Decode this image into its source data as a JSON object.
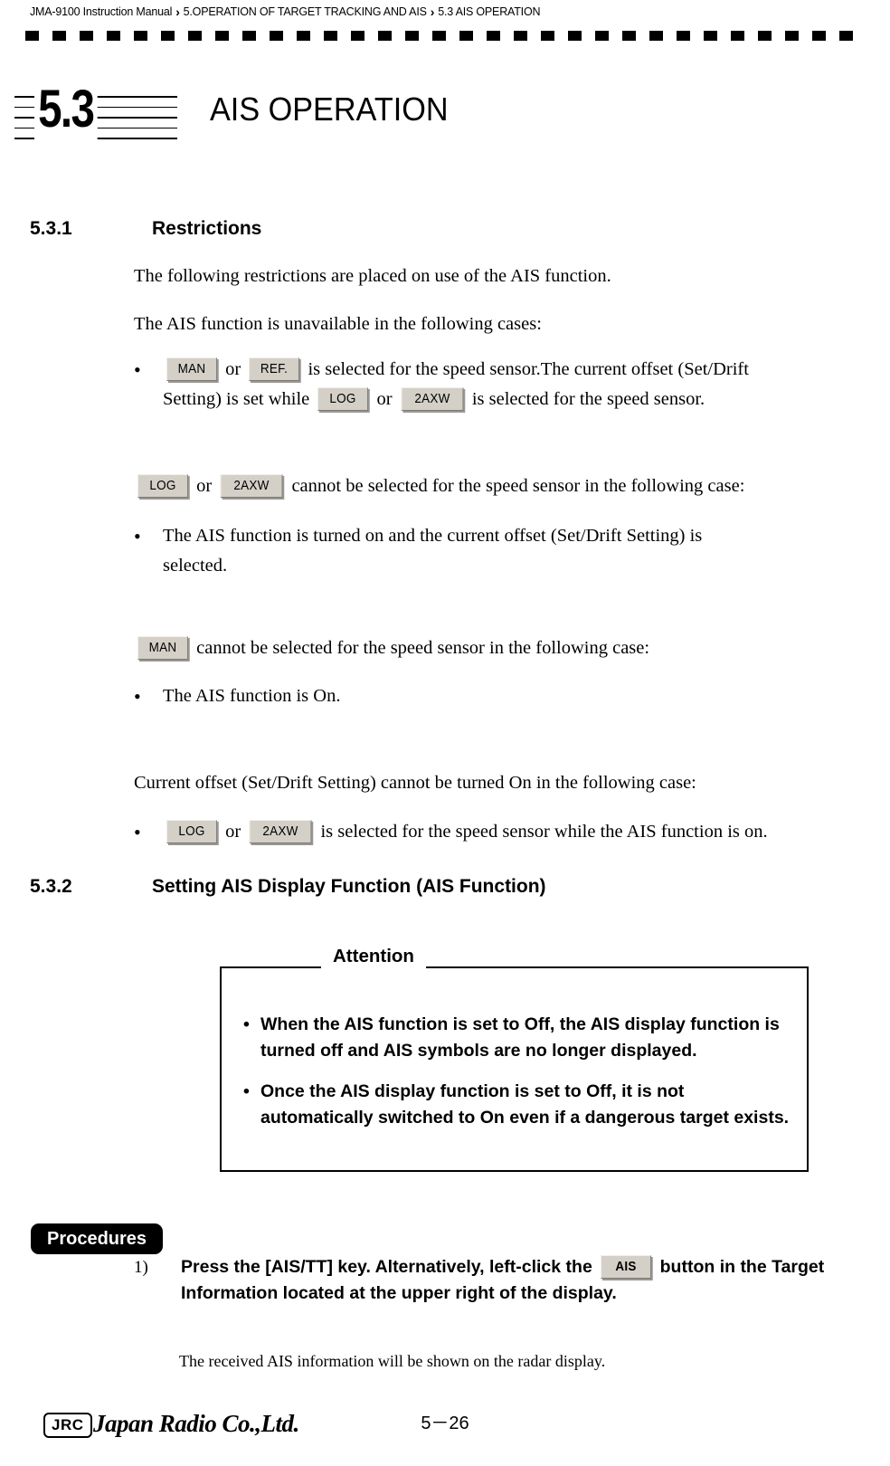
{
  "header": {
    "breadcrumb_parts": [
      "JMA-9100 Instruction Manual",
      "5.OPERATION OF TARGET TRACKING AND AIS",
      "5.3  AIS OPERATION"
    ],
    "separator": "›"
  },
  "chapter": {
    "number": "5.3",
    "title": "AIS OPERATION"
  },
  "sections": {
    "s531": {
      "number": "5.3.1",
      "title": "Restrictions"
    },
    "s532": {
      "number": "5.3.2",
      "title": "Setting AIS Display Function (AIS Function)"
    }
  },
  "body": {
    "p1": "The following restrictions are placed on use of the AIS function.",
    "p2": "The AIS function is unavailable in the following cases:",
    "b1": {
      "dot": "•",
      "t1": "or",
      "t2": "is selected for the speed sensor.The current offset (Set/Drift",
      "t3": "Setting) is set while",
      "t4": "or",
      "t5": "is selected for the speed sensor."
    },
    "p3": {
      "t1": "or",
      "t2": "cannot be selected for the speed sensor in the following case:"
    },
    "b2": {
      "dot": "•",
      "t1": "The AIS function is turned on and the current offset (Set/Drift Setting) is",
      "t2": "selected."
    },
    "p4": {
      "t1": "cannot be selected for the speed sensor in the following case:"
    },
    "b3": {
      "dot": "•",
      "t1": "The AIS function is On."
    },
    "p5": "Current offset (Set/Drift Setting) cannot be turned On in the following case:",
    "b4": {
      "dot": "•",
      "t1": "or",
      "t2": "is selected for the speed sensor while the AIS function is on."
    }
  },
  "keys": {
    "man": "MAN",
    "ref": "REF.",
    "log": "LOG",
    "axw": "2AXW",
    "ais": "AIS"
  },
  "attention": {
    "label": "Attention",
    "items": [
      {
        "dot": "•",
        "text": "When the AIS function is set to Off, the AIS display function is turned off and AIS symbols are no longer displayed."
      },
      {
        "dot": "•",
        "text": "Once the AIS display function is set to Off, it is not automatically switched to On even if a dangerous target exists."
      }
    ]
  },
  "procedures": {
    "tag": "Procedures",
    "step_number": "1)",
    "step_text_1": "Press the [AIS/TT] key. Alternatively, left-click the",
    "step_text_2": "button in the Target Information located at the upper right of the display.",
    "note": "The received AIS information will be shown on the radar display."
  },
  "footer": {
    "logo_mark": "JRC",
    "company": "Japan Radio Co.,Ltd.",
    "page": "5－26"
  }
}
